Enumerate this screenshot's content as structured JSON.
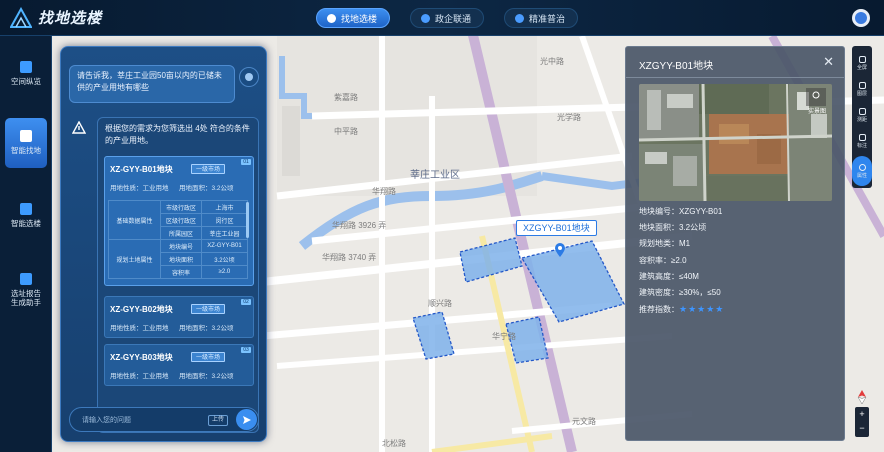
{
  "header": {
    "title": "找地选楼",
    "tabs": [
      {
        "label": "找地选楼",
        "active": true
      },
      {
        "label": "政企联通",
        "active": false
      },
      {
        "label": "精准普治",
        "active": false
      }
    ]
  },
  "sidebar": {
    "items": [
      {
        "label": "空间纵览",
        "icon": "cube-icon",
        "active": false
      },
      {
        "label": "智能找地",
        "icon": "map-search-icon",
        "active": true
      },
      {
        "label": "智能选楼",
        "icon": "building-icon",
        "active": false
      },
      {
        "label": "选址报告生成助手",
        "icon": "report-icon",
        "active": false
      }
    ]
  },
  "map": {
    "labels": {
      "guangzhong_rd": "光中路",
      "zijia_rd": "紫嘉路",
      "zhongping_rd": "中平路",
      "guangxue_rd": "光学路",
      "xinzhuang_park": "莘庄工业区",
      "huaxiang_rd": "华翔路",
      "huaxiang_rd_3926": "华翔路 3926 弄",
      "huaxiang_rd_3740": "华翔路 3740 弄",
      "shunxing_rd": "顺兴路",
      "huaning_rd": "华宁路",
      "yuanwen_rd": "元文路",
      "beisong_rd": "北松路"
    },
    "marker": {
      "label": "XZGYY-B01地块"
    }
  },
  "chat": {
    "user_message": "请告诉我，莘庄工业园50亩以内的已储未供的产业用地有哪些",
    "ai_message": "根据您的需求为您筛选出 4处 符合的条件的产业用地。",
    "plots": [
      {
        "name": "XZ-GYY-B01地块",
        "badge": "一级市场",
        "corner": "01",
        "nature_label": "用地性质：",
        "nature": "工业用地",
        "area_label": "用地面积：",
        "area": "3.2公顷",
        "attributes": {
          "group1": "基础数据属性",
          "group2": "规划土地属性",
          "rows": [
            {
              "key": "市级行政区",
              "value": "上海市"
            },
            {
              "key": "区级行政区",
              "value": "闵行区"
            },
            {
              "key": "所属园区",
              "value": "莘庄工业园"
            },
            {
              "key": "地块编号",
              "value": "XZ-GYY-B01"
            },
            {
              "key": "地块面积",
              "value": "3.2公顷"
            },
            {
              "key": "容积率",
              "value": "≥2.0"
            }
          ]
        }
      },
      {
        "name": "XZ-GYY-B02地块",
        "badge": "一级市场",
        "corner": "02",
        "nature_label": "用地性质：",
        "nature": "工业用地",
        "area_label": "用地面积：",
        "area": "3.2公顷"
      },
      {
        "name": "XZ-GYY-B03地块",
        "badge": "一级市场",
        "corner": "03",
        "nature_label": "用地性质：",
        "nature": "工业用地",
        "area_label": "用地面积：",
        "area": "3.2公顷"
      }
    ],
    "input_placeholder": "请输入您的问题",
    "upload_label": "上传"
  },
  "detail": {
    "title": "XZGYY-B01地块",
    "image_caption": "实景图",
    "rows": [
      {
        "label": "地块编号：",
        "value": "XZGYY-B01"
      },
      {
        "label": "地块面积：",
        "value": "3.2公顷"
      },
      {
        "label": "规划地类：",
        "value": "M1"
      },
      {
        "label": "容积率：",
        "value": "≥2.0"
      },
      {
        "label": "建筑高度：",
        "value": "≤40M"
      },
      {
        "label": "建筑密度：",
        "value": "≥30%，≤50"
      }
    ],
    "rating_label": "推荐指数：",
    "rating": 5,
    "rating_stars": "★★★★★"
  },
  "toolbar": {
    "items": [
      {
        "label": "全屏",
        "icon": "fullscreen-icon"
      },
      {
        "label": "图层",
        "icon": "layers-icon"
      },
      {
        "label": "测距",
        "icon": "ruler-icon"
      },
      {
        "label": "标注",
        "icon": "pin-icon"
      },
      {
        "label": "属性",
        "icon": "info-icon",
        "active": true
      }
    ],
    "zoom_in": "+",
    "zoom_out": "−"
  },
  "colors": {
    "accent": "#2f86ee",
    "panel": "#1d4f86",
    "plot_fill": "#7fb2ea",
    "plot_border": "#2458c8",
    "road_purple": "#c9b2d6",
    "road_yellow": "#f7e9a4"
  }
}
